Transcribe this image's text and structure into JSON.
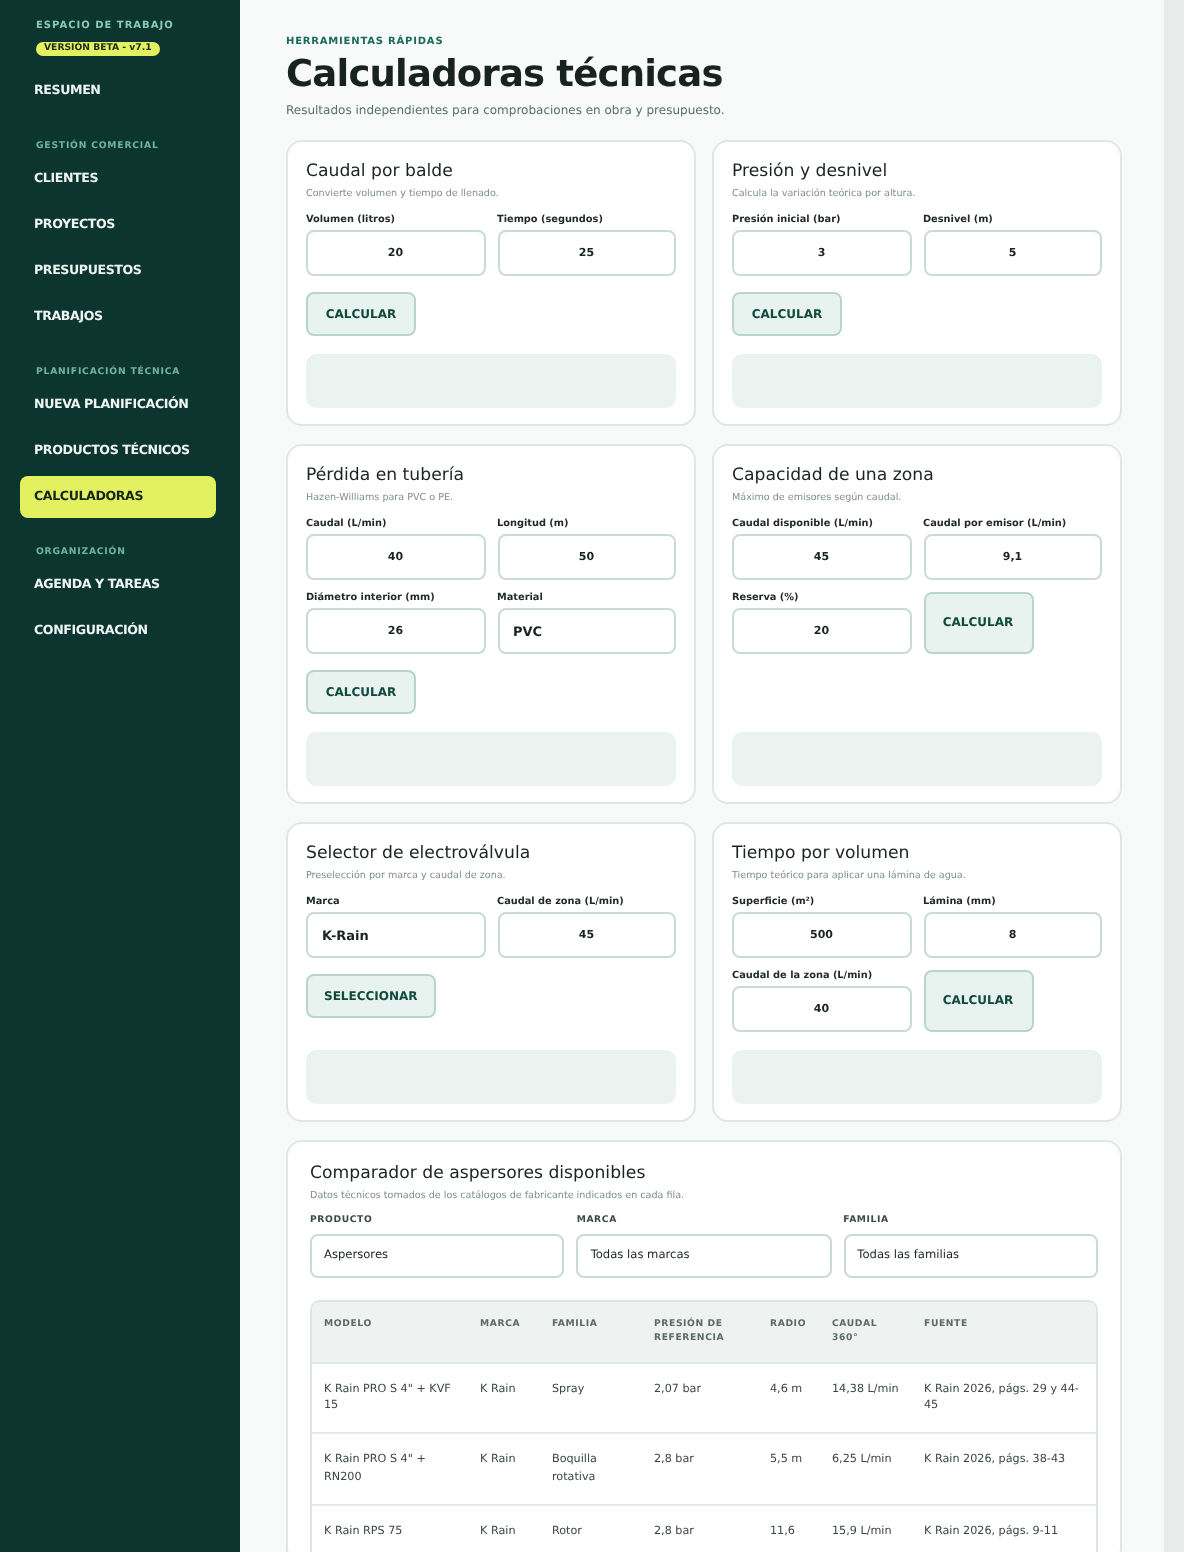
{
  "sidebar": {
    "workspace_label": "ESPACIO DE TRABAJO",
    "version_badge": "VERSIÓN BETA - v7.1",
    "groups": [
      {
        "items": [
          {
            "label": "RESUMEN",
            "selected": false
          }
        ]
      },
      {
        "heading": "GESTIÓN COMERCIAL",
        "items": [
          {
            "label": "CLIENTES",
            "selected": false
          },
          {
            "label": "PROYECTOS",
            "selected": false
          },
          {
            "label": "PRESUPUESTOS",
            "selected": false
          },
          {
            "label": "TRABAJOS",
            "selected": false
          }
        ]
      },
      {
        "heading": "PLANIFICACIÓN TÉCNICA",
        "items": [
          {
            "label": "NUEVA PLANIFICACIÓN",
            "selected": false
          },
          {
            "label": "PRODUCTOS TÉCNICOS",
            "selected": false
          },
          {
            "label": "CALCULADORAS",
            "selected": true
          }
        ]
      },
      {
        "heading": "ORGANIZACIÓN",
        "items": [
          {
            "label": "AGENDA Y TAREAS",
            "selected": false
          },
          {
            "label": "CONFIGURACIÓN",
            "selected": false
          }
        ]
      }
    ]
  },
  "header": {
    "eyebrow": "HERRAMIENTAS RÁPIDAS",
    "title": "Calculadoras técnicas",
    "subtitle": "Resultados independientes para comprobaciones en obra y presupuesto."
  },
  "calculators": [
    {
      "title": "Caudal por balde",
      "subtitle": "Convierte volumen y tiempo de llenado.",
      "fields": [
        {
          "kind": "input",
          "label": "Volumen (litros)",
          "value": "20"
        },
        {
          "kind": "input",
          "label": "Tiempo (segundos)",
          "value": "25"
        },
        {
          "kind": "button",
          "label": "CALCULAR"
        }
      ]
    },
    {
      "title": "Presión y desnivel",
      "subtitle": "Calcula la variación teórica por altura.",
      "fields": [
        {
          "kind": "input",
          "label": "Presión inicial (bar)",
          "value": "3"
        },
        {
          "kind": "input",
          "label": "Desnivel (m)",
          "value": "5"
        },
        {
          "kind": "button",
          "label": "CALCULAR"
        }
      ]
    },
    {
      "title": "Pérdida en tubería",
      "subtitle": "Hazen-Williams para PVC o PE.",
      "fields": [
        {
          "kind": "input",
          "label": "Caudal (L/min)",
          "value": "40"
        },
        {
          "kind": "input",
          "label": "Longitud (m)",
          "value": "50"
        },
        {
          "kind": "input",
          "label": "Diámetro interior (mm)",
          "value": "26"
        },
        {
          "kind": "select",
          "label": "Material",
          "value": "PVC"
        },
        {
          "kind": "button",
          "label": "CALCULAR"
        }
      ]
    },
    {
      "title": "Capacidad de una zona",
      "subtitle": "Máximo de emisores según caudal.",
      "fields": [
        {
          "kind": "input",
          "label": "Caudal disponible (L/min)",
          "value": "45"
        },
        {
          "kind": "input",
          "label": "Caudal por emisor (L/min)",
          "value": "9,1"
        },
        {
          "kind": "input",
          "label": "Reserva (%)",
          "value": "20"
        },
        {
          "kind": "button",
          "label": "CALCULAR"
        }
      ]
    },
    {
      "title": "Selector de electroválvula",
      "subtitle": "Preselección por marca y caudal de zona.",
      "fields": [
        {
          "kind": "select",
          "label": "Marca",
          "value": "K-Rain"
        },
        {
          "kind": "input",
          "label": "Caudal de zona (L/min)",
          "value": "45"
        },
        {
          "kind": "button",
          "label": "SELECCIONAR"
        }
      ]
    },
    {
      "title": "Tiempo por volumen",
      "subtitle": "Tiempo teórico para aplicar una lámina de agua.",
      "fields": [
        {
          "kind": "input",
          "label": "Superficie (m²)",
          "value": "500"
        },
        {
          "kind": "input",
          "label": "Lámina (mm)",
          "value": "8"
        },
        {
          "kind": "input",
          "label": "Caudal de la zona (L/min)",
          "value": "40"
        },
        {
          "kind": "button",
          "label": "CALCULAR"
        }
      ]
    }
  ],
  "comparator": {
    "title": "Comparador de aspersores disponibles",
    "subtitle": "Datos técnicos tomados de los catálogos de fabricante indicados en cada fila.",
    "filters": [
      {
        "label": "PRODUCTO",
        "value": "Aspersores"
      },
      {
        "label": "MARCA",
        "value": "Todas las marcas"
      },
      {
        "label": "FAMILIA",
        "value": "Todas las familias"
      }
    ],
    "table": {
      "columns": [
        "MODELO",
        "MARCA",
        "FAMILIA",
        "PRESIÓN DE REFERENCIA",
        "RADIO",
        "CAUDAL 360°",
        "FUENTE"
      ],
      "rows": [
        [
          "K Rain PRO S 4\" + KVF 15",
          "K Rain",
          "Spray",
          "2,07 bar",
          "4,6 m",
          "14,38 L/min",
          "K Rain 2026, págs. 29 y 44-45"
        ],
        [
          "K Rain PRO S 4\" + RN200",
          "K Rain",
          "Boquilla rotativa",
          "2,8 bar",
          "5,5 m",
          "6,25 L/min",
          "K Rain 2026, págs. 38-43"
        ],
        [
          "K Rain RPS 75",
          "K Rain",
          "Rotor",
          "2,8 bar",
          "11,6",
          "15,9 L/min",
          "K Rain 2026, págs. 9-11"
        ]
      ]
    }
  }
}
